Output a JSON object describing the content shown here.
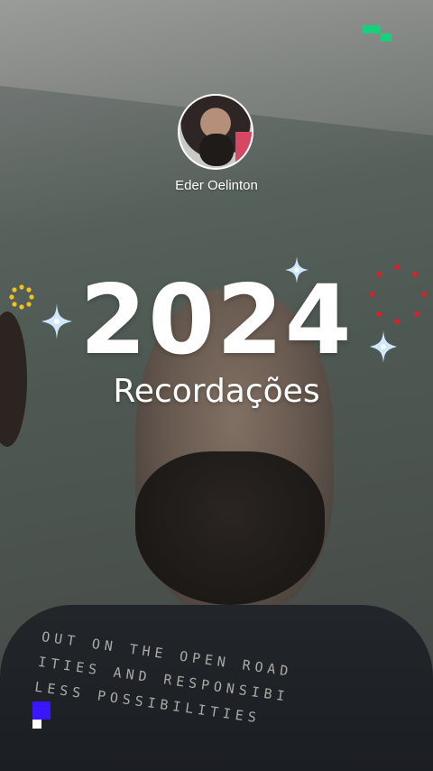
{
  "profile": {
    "name": "Eder Oelinton"
  },
  "title": {
    "year": "2024",
    "subtitle": "Recordações"
  },
  "decor": {
    "sparkle_color": "#cfe8ff",
    "sparkle_core": "#ffffff",
    "gold_dots_color": "#f2c21b",
    "red_dots_color": "#d3242d",
    "brand_mark_color": "#19d07a",
    "square_mark_color": "#3a16ff"
  },
  "shirt_text": {
    "line1": "OUT ON THE OPEN ROAD",
    "line2": "ITIES AND RESPONSIBI",
    "line3": "LESS POSSIBILITIES"
  }
}
